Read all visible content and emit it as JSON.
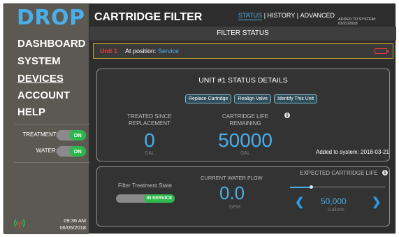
{
  "app": {
    "logo": "DROP",
    "page_title": "CARTRIDGE FILTER"
  },
  "tabs": [
    {
      "label": "STATUS",
      "active": true
    },
    {
      "label": "HISTORY",
      "active": false
    },
    {
      "label": "ADVANCED",
      "active": false
    }
  ],
  "header": {
    "tab_separator": "|",
    "added_to_system": "ADDED TO SYSTEM: 03/21/2018"
  },
  "sidebar": {
    "nav": [
      {
        "label": "DASHBOARD",
        "active": false
      },
      {
        "label": "SYSTEM",
        "active": false
      },
      {
        "label": "DEVICES",
        "active": true
      },
      {
        "label": "ACCOUNT",
        "active": false
      },
      {
        "label": "HELP",
        "active": false
      }
    ],
    "toggles": [
      {
        "label": "TREATMENT:",
        "state": "ON"
      },
      {
        "label": "WATER:",
        "state": "ON"
      }
    ],
    "time": "09:36 AM",
    "date": "06/05/2018",
    "status_icon": "signal-icon"
  },
  "filter_status": {
    "heading": "FILTER STATUS",
    "unit_name": "Unit 1",
    "position_label": "At position:",
    "position_value": "Service",
    "battery_icon": "battery-empty-icon"
  },
  "details": {
    "title": "UNIT #1 STATUS DETAILS",
    "buttons": [
      "Replace Cartridge",
      "Realign Valve",
      "Identify This Unit"
    ],
    "treated_label_1": "TREATED SINCE",
    "treated_label_2": "REPLACEMENT",
    "treated_value": "0",
    "treated_unit": "GAL",
    "life_label_1": "CARTRIDGE LIFE",
    "life_label_2": "REMAINING",
    "life_value": "50000",
    "life_unit": "GAL",
    "added_to_system": "Added to system: 2018-03-21",
    "info_glyph": "i"
  },
  "controls": {
    "treatment_state_label": "Filter Treatment State",
    "treatment_state_value": "IN SERVICE",
    "flow_label": "CURRENT WATER FLOW",
    "flow_value": "0.0",
    "flow_unit": "GPM",
    "expected_life_label": "EXPECTED CARTRIDGE LIFE",
    "expected_life_value": "50,000",
    "expected_life_unit": "Gallons",
    "slider_fraction": 0.22,
    "prev_glyph": "❮",
    "next_glyph": "❯"
  },
  "colors": {
    "accent": "#4aaee8",
    "toggle_on": "#2eb84b",
    "alert": "#e23a3a",
    "unit_border": "#c8a432"
  }
}
